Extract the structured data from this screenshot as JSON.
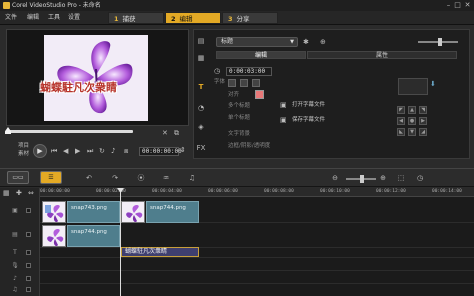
{
  "window": {
    "title": "Corel VideoStudio Pro - 未命名",
    "minimize_icon": "minimize-icon",
    "maximize_icon": "maximize-icon",
    "close_icon": "close-icon"
  },
  "menu": {
    "items": [
      "文件",
      "编辑",
      "工具",
      "设置"
    ]
  },
  "steps": [
    {
      "num": "1",
      "label": "捕获"
    },
    {
      "num": "2",
      "label": "编辑"
    },
    {
      "num": "3",
      "label": "分享"
    }
  ],
  "preview": {
    "overlay_text": "蝴蝶駐凡次衆睛",
    "mode_project": "项目",
    "mode_clip": "素材",
    "timecode": "00:00:00:00",
    "accent": "#e3a925"
  },
  "library": {
    "dropdown": "标题"
  },
  "options": {
    "tab_edit": "编辑",
    "tab_attribute": "属性",
    "duration": "0:00:03:00",
    "open_subtitle": "打开字幕文件",
    "save_subtitle": "保存字幕文件",
    "color_swatch": "#e87878",
    "multi_title": "多个标题",
    "single_title": "单个标题",
    "text_bg": "文字背景",
    "font_size_label": "字体",
    "border_label": "边框/阴影/透明度",
    "alignment_label": "对齐"
  },
  "timeline": {
    "ruler": [
      "00:00:00:00",
      "00:00:02:00",
      "00:00:04:00",
      "00:00:06:00",
      "00:00:08:00",
      "00:00:10:00",
      "00:00:12:00",
      "00:00:14:00"
    ],
    "clips_video": [
      "snap743.png",
      "snap744.png"
    ],
    "clips_overlay": [
      "snap744.png"
    ],
    "title_clip": "蝴蝶駐凡次衆睛"
  }
}
